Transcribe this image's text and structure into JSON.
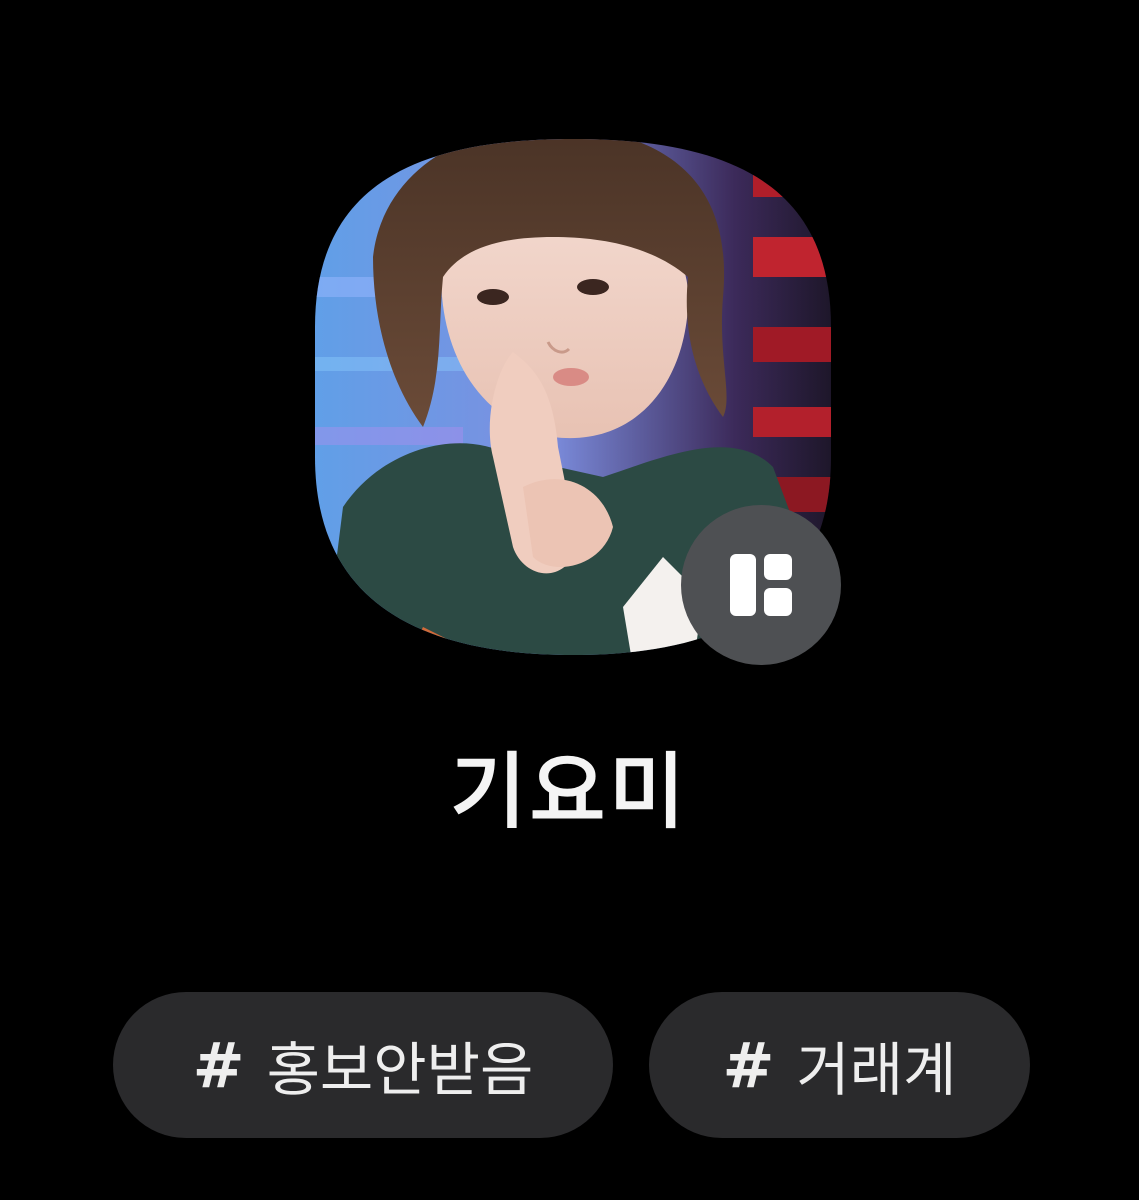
{
  "profile": {
    "name": "기요미",
    "avatar_alt": "profile photo",
    "badge_icon": "layout-grid-icon"
  },
  "tags": [
    {
      "symbol": "#",
      "label": "홍보안받음"
    },
    {
      "symbol": "#",
      "label": "거래계"
    }
  ],
  "colors": {
    "background": "#000000",
    "tag_background": "#2a2a2c",
    "badge_background": "#4e5053",
    "text": "#f4f4f4"
  }
}
